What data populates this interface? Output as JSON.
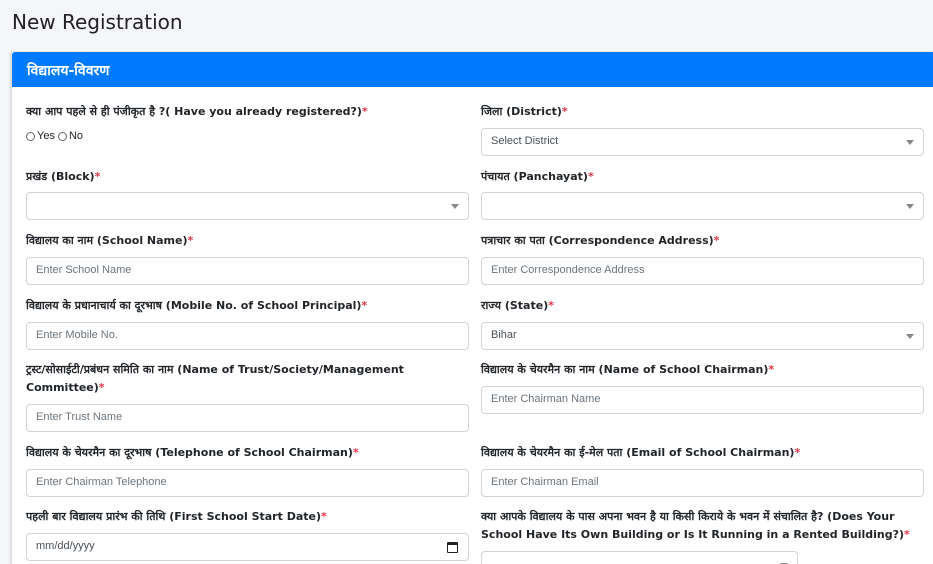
{
  "page": {
    "title": "New Registration"
  },
  "section": {
    "title": "विद्यालय-विवरण"
  },
  "fields": {
    "registered": {
      "label": "क्या आप पहले से ही पंजीकृत है ?( Have you already registered?)",
      "options": [
        "Yes",
        "No"
      ]
    },
    "district": {
      "label": "जिला (District)",
      "value": "Select District"
    },
    "block": {
      "label": "प्रखंड (Block)",
      "value": ""
    },
    "panchayat": {
      "label": "पंचायत (Panchayat)",
      "value": ""
    },
    "school_name": {
      "label": "विद्यालय का नाम (School Name)",
      "placeholder": "Enter School Name"
    },
    "address": {
      "label": "पत्राचार का पता (Correspondence Address)",
      "placeholder": "Enter Correspondence Address"
    },
    "principal_mobile": {
      "label": "विद्यालय के प्रधानाचार्य का दूरभाष (Mobile No. of School Principal)",
      "placeholder": "Enter Mobile No."
    },
    "state": {
      "label": "राज्य (State)",
      "value": "Bihar"
    },
    "trust_name": {
      "label": "ट्रस्ट/सोसाईटी/प्रबंधन समिति का नाम (Name of Trust/Society/Management Committee)",
      "placeholder": "Enter Trust Name"
    },
    "chairman_name": {
      "label": "विद्यालय के चेयरमैन का नाम (Name of School Chairman)",
      "placeholder": "Enter Chairman Name"
    },
    "chairman_phone": {
      "label": "विद्यालय के चेयरमैन का दूरभाष (Telephone of School Chairman)",
      "placeholder": "Enter Chairman Telephone"
    },
    "chairman_email": {
      "label": "विद्यालय के चेयरमैन का ई-मेल पता (Email of School Chairman)",
      "placeholder": "Enter Chairman Email"
    },
    "start_date": {
      "label": "पहली बार विद्यालय प्रारंभ की तिथि (First School Start Date)",
      "placeholder": "mm/dd/yyyy"
    },
    "building": {
      "label": "क्या आपके विद्यालय के पास अपना भवन है या किसी किराये के भवन में संचालित है? (Does Your School Have Its Own Building or Is It Running in a Rented Building?)"
    }
  },
  "required_mark": "*",
  "colors": {
    "header_bg": "#007bff",
    "required": "#dc3545"
  }
}
